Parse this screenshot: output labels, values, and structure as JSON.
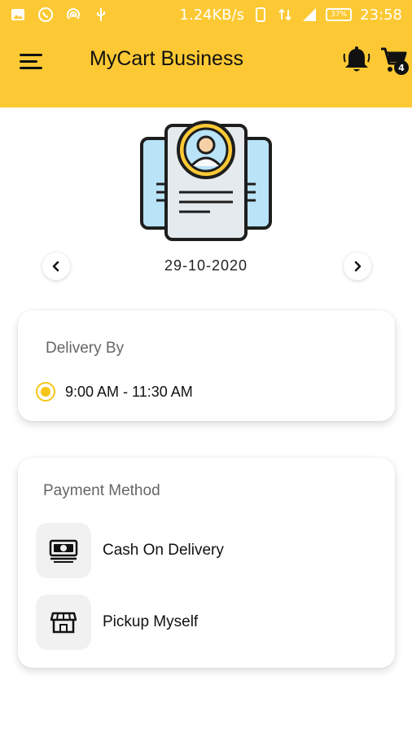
{
  "status_bar": {
    "speed": "1.24KB/s",
    "battery": "37%",
    "time": "23:58",
    "icons": [
      "image-icon",
      "whatsapp-icon",
      "hotspot-icon",
      "usb-icon",
      "phone-icon",
      "data-icon",
      "signal-icon",
      "battery-icon"
    ]
  },
  "app_bar": {
    "title": "MyCart Business",
    "cart_count": "4",
    "background": "#fcc934"
  },
  "date_selector": {
    "date": "29-10-2020"
  },
  "delivery": {
    "title": "Delivery By",
    "slots": [
      {
        "label": "9:00 AM - 11:30 AM",
        "selected": true
      }
    ]
  },
  "payment": {
    "title": "Payment Method",
    "options": [
      {
        "label": "Cash On Delivery",
        "icon": "cash-icon"
      },
      {
        "label": "Pickup Myself",
        "icon": "store-icon"
      }
    ]
  },
  "colors": {
    "accent": "#fcc934",
    "radio": "#f5c518"
  }
}
